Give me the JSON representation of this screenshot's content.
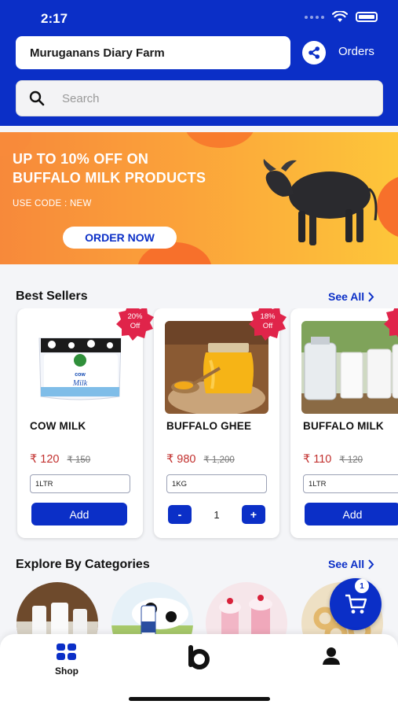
{
  "status_bar": {
    "time": "2:17"
  },
  "header": {
    "store_name": "Muruganans Diary Farm",
    "orders_label": "Orders",
    "search_placeholder": "Search"
  },
  "banner": {
    "title_line1": "UP TO 10% OFF ON",
    "title_line2": "BUFFALO MILK PRODUCTS",
    "code_text": "USE CODE : NEW",
    "cta_label": "ORDER NOW"
  },
  "best_sellers": {
    "title": "Best Sellers",
    "see_all": "See All",
    "products": [
      {
        "name": "COW MILK",
        "price": "₹ 120",
        "mrp": "₹ 150",
        "size": "1LTR",
        "badge_pct": "20%",
        "badge_off": "Off",
        "action": "Add"
      },
      {
        "name": "BUFFALO GHEE",
        "price": "₹ 980",
        "mrp": "₹ 1,200",
        "size": "1KG",
        "badge_pct": "18%",
        "badge_off": "Off",
        "quantity": "1",
        "minus": "-",
        "plus": "+"
      },
      {
        "name": "BUFFALO MILK",
        "price": "₹ 110",
        "mrp": "₹ 120",
        "size": "1LTR",
        "action": "Add"
      }
    ]
  },
  "categories": {
    "title": "Explore By Categories",
    "see_all": "See All"
  },
  "cart": {
    "count": "1"
  },
  "bottom_nav": {
    "shop_label": "Shop"
  },
  "colors": {
    "brand_blue": "#0b2fc7",
    "badge_red": "#e0244a",
    "price_red": "#c2302e"
  }
}
